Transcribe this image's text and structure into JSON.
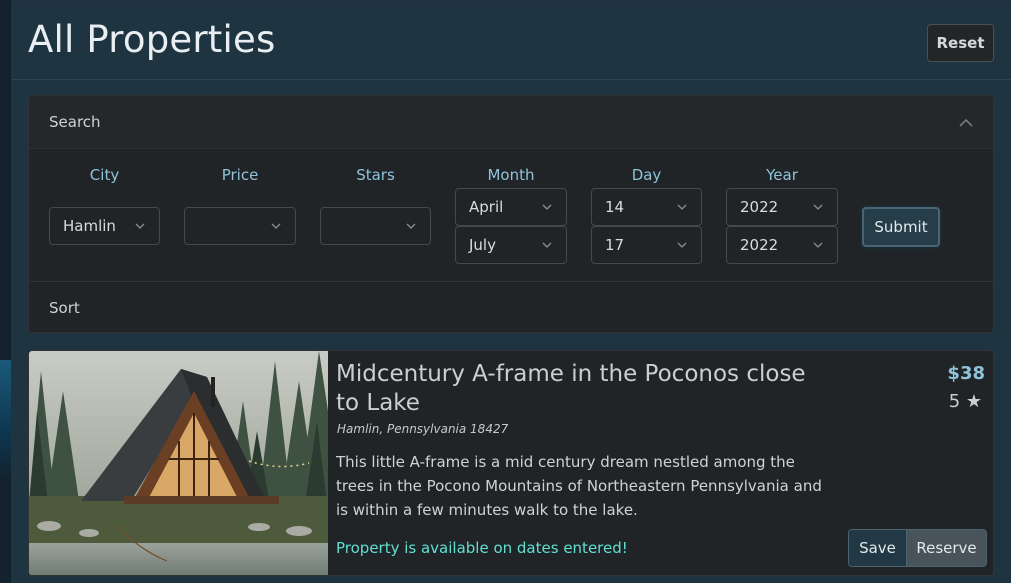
{
  "header": {
    "title": "All Properties",
    "reset_label": "Reset"
  },
  "search": {
    "heading": "Search",
    "fields": {
      "city": {
        "label": "City",
        "value": "Hamlin"
      },
      "price": {
        "label": "Price",
        "value": ""
      },
      "stars": {
        "label": "Stars",
        "value": ""
      },
      "month": {
        "label": "Month",
        "from": "April",
        "to": "July"
      },
      "day": {
        "label": "Day",
        "from": "14",
        "to": "17"
      },
      "year": {
        "label": "Year",
        "from": "2022",
        "to": "2022"
      }
    },
    "submit_label": "Submit"
  },
  "sort": {
    "heading": "Sort"
  },
  "listing": {
    "title": "Midcentury A-frame in the Poconos close to Lake",
    "location": "Hamlin, Pennsylvania 18427",
    "description": "This little A-frame is a mid century dream nestled among the trees in the Pocono Mountains of Northeastern Pennsylvania and is within a few minutes walk to the lake.",
    "availability": "Property is available on dates entered!",
    "price": "$38",
    "stars": "5 ★",
    "save_label": "Save",
    "reserve_label": "Reserve"
  },
  "icons": {
    "search_toggle": "chevron-up-icon",
    "select_caret": "chevron-down-icon"
  },
  "colors": {
    "accent": "#8fc3d9",
    "available": "#5fe0d2",
    "background": "#1e3440"
  }
}
